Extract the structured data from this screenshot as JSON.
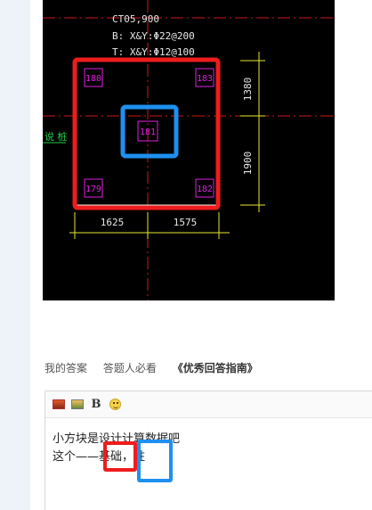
{
  "drawing": {
    "ct_label": "CT05,900",
    "b_label": "B: X&Y:Φ22@200",
    "t_label": "T: X&Y:Φ12@100",
    "pile_tl": "180",
    "pile_tr": "183",
    "pile_center": "181",
    "pile_bl": "179",
    "pile_br": "182",
    "dim_top": "1380",
    "dim_bottom": "1900",
    "dim_left": "1625",
    "dim_right": "1575",
    "side_text": "说 桩"
  },
  "answer_tabs": {
    "my_answer": "我的答案",
    "must_read": "答题人必看",
    "guide": "《优秀回答指南》"
  },
  "editor": {
    "line1": "小方块是设计计算数据吧",
    "line2": "这个——基础，柱"
  },
  "colors": {
    "red_mark": "#ee1c1c",
    "blue_mark": "#1e90f0",
    "magenta": "#e020e0",
    "dim_yellow": "#e8e830"
  }
}
